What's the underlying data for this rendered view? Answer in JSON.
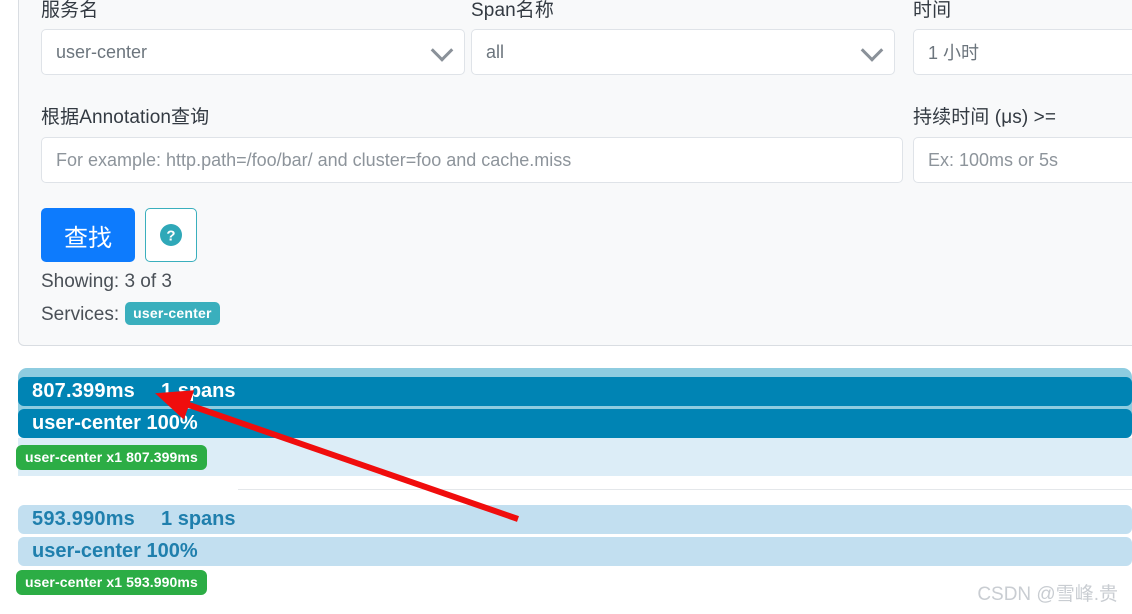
{
  "search_panel": {
    "fields": [
      {
        "label": "服务名",
        "value": "user-center",
        "placeholder": "",
        "control": "select"
      },
      {
        "label": "Span名称",
        "value": "all",
        "placeholder": "",
        "control": "select"
      },
      {
        "label": "时间",
        "value": "1 小时",
        "placeholder": "",
        "control": "select"
      },
      {
        "label": "根据Annotation查询",
        "value": "",
        "placeholder": "For example: http.path=/foo/bar/ and cluster=foo and cache.miss",
        "control": "text"
      },
      {
        "label": "持续时间 (μs) >=",
        "value": "",
        "placeholder": "Ex: 100ms or 5s",
        "control": "text"
      }
    ],
    "search_button": "查找",
    "help_button_title": "?",
    "showing_label": "Showing: 3 of 3",
    "services_label": "Services:",
    "services": [
      "user-center"
    ]
  },
  "results": [
    {
      "duration": "807.399ms",
      "spans": "1 spans",
      "service_percent": "user-center 100%",
      "span_badge": "user-center x1 807.399ms",
      "state": "selected"
    },
    {
      "duration": "593.990ms",
      "spans": "1 spans",
      "service_percent": "user-center 100%",
      "span_badge": "user-center x1 593.990ms",
      "state": "idle"
    }
  ],
  "annotation": {
    "arrow_color": "#f00d0d",
    "points_to": "1 spans"
  },
  "watermark": "CSDN @雪峰.贵",
  "colors": {
    "primary_button": "#0d7bfd",
    "selected_band": "#0084b4",
    "idle_band": "#c2dff0",
    "service_badge": "#3aafbd",
    "span_badge": "#2cad45",
    "panel_bg": "#f8f9fa"
  }
}
